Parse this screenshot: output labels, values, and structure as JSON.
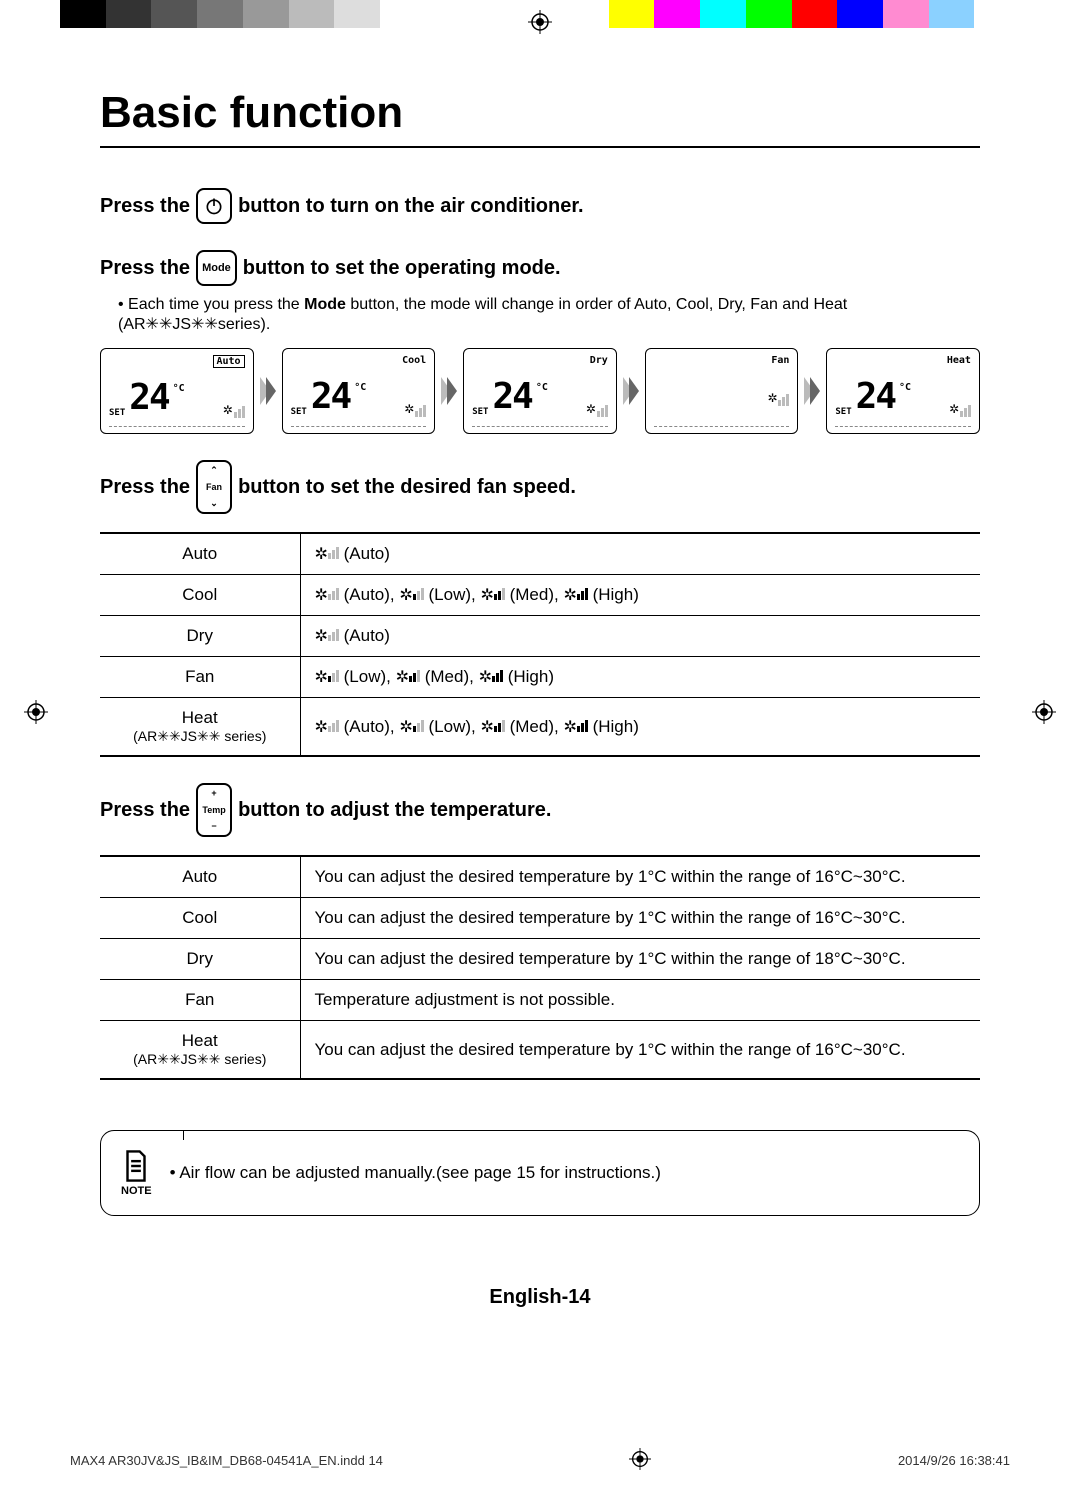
{
  "title": "Basic function",
  "line1": {
    "pre": "Press the",
    "post": "button to turn on the air conditioner."
  },
  "line2": {
    "pre": "Press the",
    "btn": "Mode",
    "post": "button to set the operating mode."
  },
  "mode_note_a": "Each time you press the ",
  "mode_note_bold": "Mode",
  "mode_note_b": " button, the mode will change in order of Auto, Cool, Dry, Fan and Heat (AR✳✳JS✳✳series).",
  "modes": [
    {
      "label": "Auto",
      "boxed": true,
      "temp": "24",
      "set": true
    },
    {
      "label": "Cool",
      "boxed": false,
      "temp": "24",
      "set": true
    },
    {
      "label": "Dry",
      "boxed": false,
      "temp": "24",
      "set": true
    },
    {
      "label": "Fan",
      "boxed": false,
      "temp": "",
      "set": false
    },
    {
      "label": "Heat",
      "boxed": false,
      "temp": "24",
      "set": true
    }
  ],
  "line3": {
    "pre": "Press the",
    "btn_top": "⌃",
    "btn_mid": "Fan",
    "btn_bot": "⌄",
    "post": "button to set the desired fan speed."
  },
  "speed_rows": [
    {
      "mode": "Auto",
      "sub": "",
      "opts": "(Auto)"
    },
    {
      "mode": "Cool",
      "sub": "",
      "opts": "(Auto),  (Low),  (Med),  (High)"
    },
    {
      "mode": "Dry",
      "sub": "",
      "opts": "(Auto)"
    },
    {
      "mode": "Fan",
      "sub": "",
      "opts": "(Low),  (Med),  (High)"
    },
    {
      "mode": "Heat",
      "sub": "(AR✳✳JS✳✳ series)",
      "opts": "(Auto),  (Low),  (Med),  (High)"
    }
  ],
  "line4": {
    "pre": "Press the",
    "btn_top": "+",
    "btn_mid": "Temp",
    "btn_bot": "−",
    "post": "button to adjust the temperature."
  },
  "temp_rows": [
    {
      "mode": "Auto",
      "txt": "You can adjust the desired temperature by 1°C within the range of 16°C~30°C."
    },
    {
      "mode": "Cool",
      "txt": "You can adjust the desired temperature by 1°C within the range of 16°C~30°C."
    },
    {
      "mode": "Dry",
      "txt": "You can adjust the desired temperature by 1°C within the range of 18°C~30°C."
    },
    {
      "mode": "Fan",
      "txt": "Temperature adjustment is not possible."
    },
    {
      "mode": "Heat",
      "sub": "(AR✳✳JS✳✳ series)",
      "txt": "You can adjust the desired temperature by 1°C within the range of 16°C~30°C."
    }
  ],
  "note_label": "NOTE",
  "note_text": "Air flow can be adjusted manually.(see page 15 for instructions.)",
  "page_num": "English-14",
  "footer_left": "MAX4 AR30JV&JS_IB&IM_DB68-04541A_EN.indd   14",
  "footer_right": "2014/9/26   16:38:41",
  "color_bar": [
    "#000",
    "#333",
    "#555",
    "#777",
    "#999",
    "#bbb",
    "#ddd",
    "#fff",
    "#fff",
    "#fff",
    "#fff",
    "#fff",
    "#ff0",
    "#f0f",
    "#0ff",
    "#0f0",
    "#f00",
    "#00f",
    "#ff8bd1",
    "#8bd1ff",
    "#fff"
  ]
}
